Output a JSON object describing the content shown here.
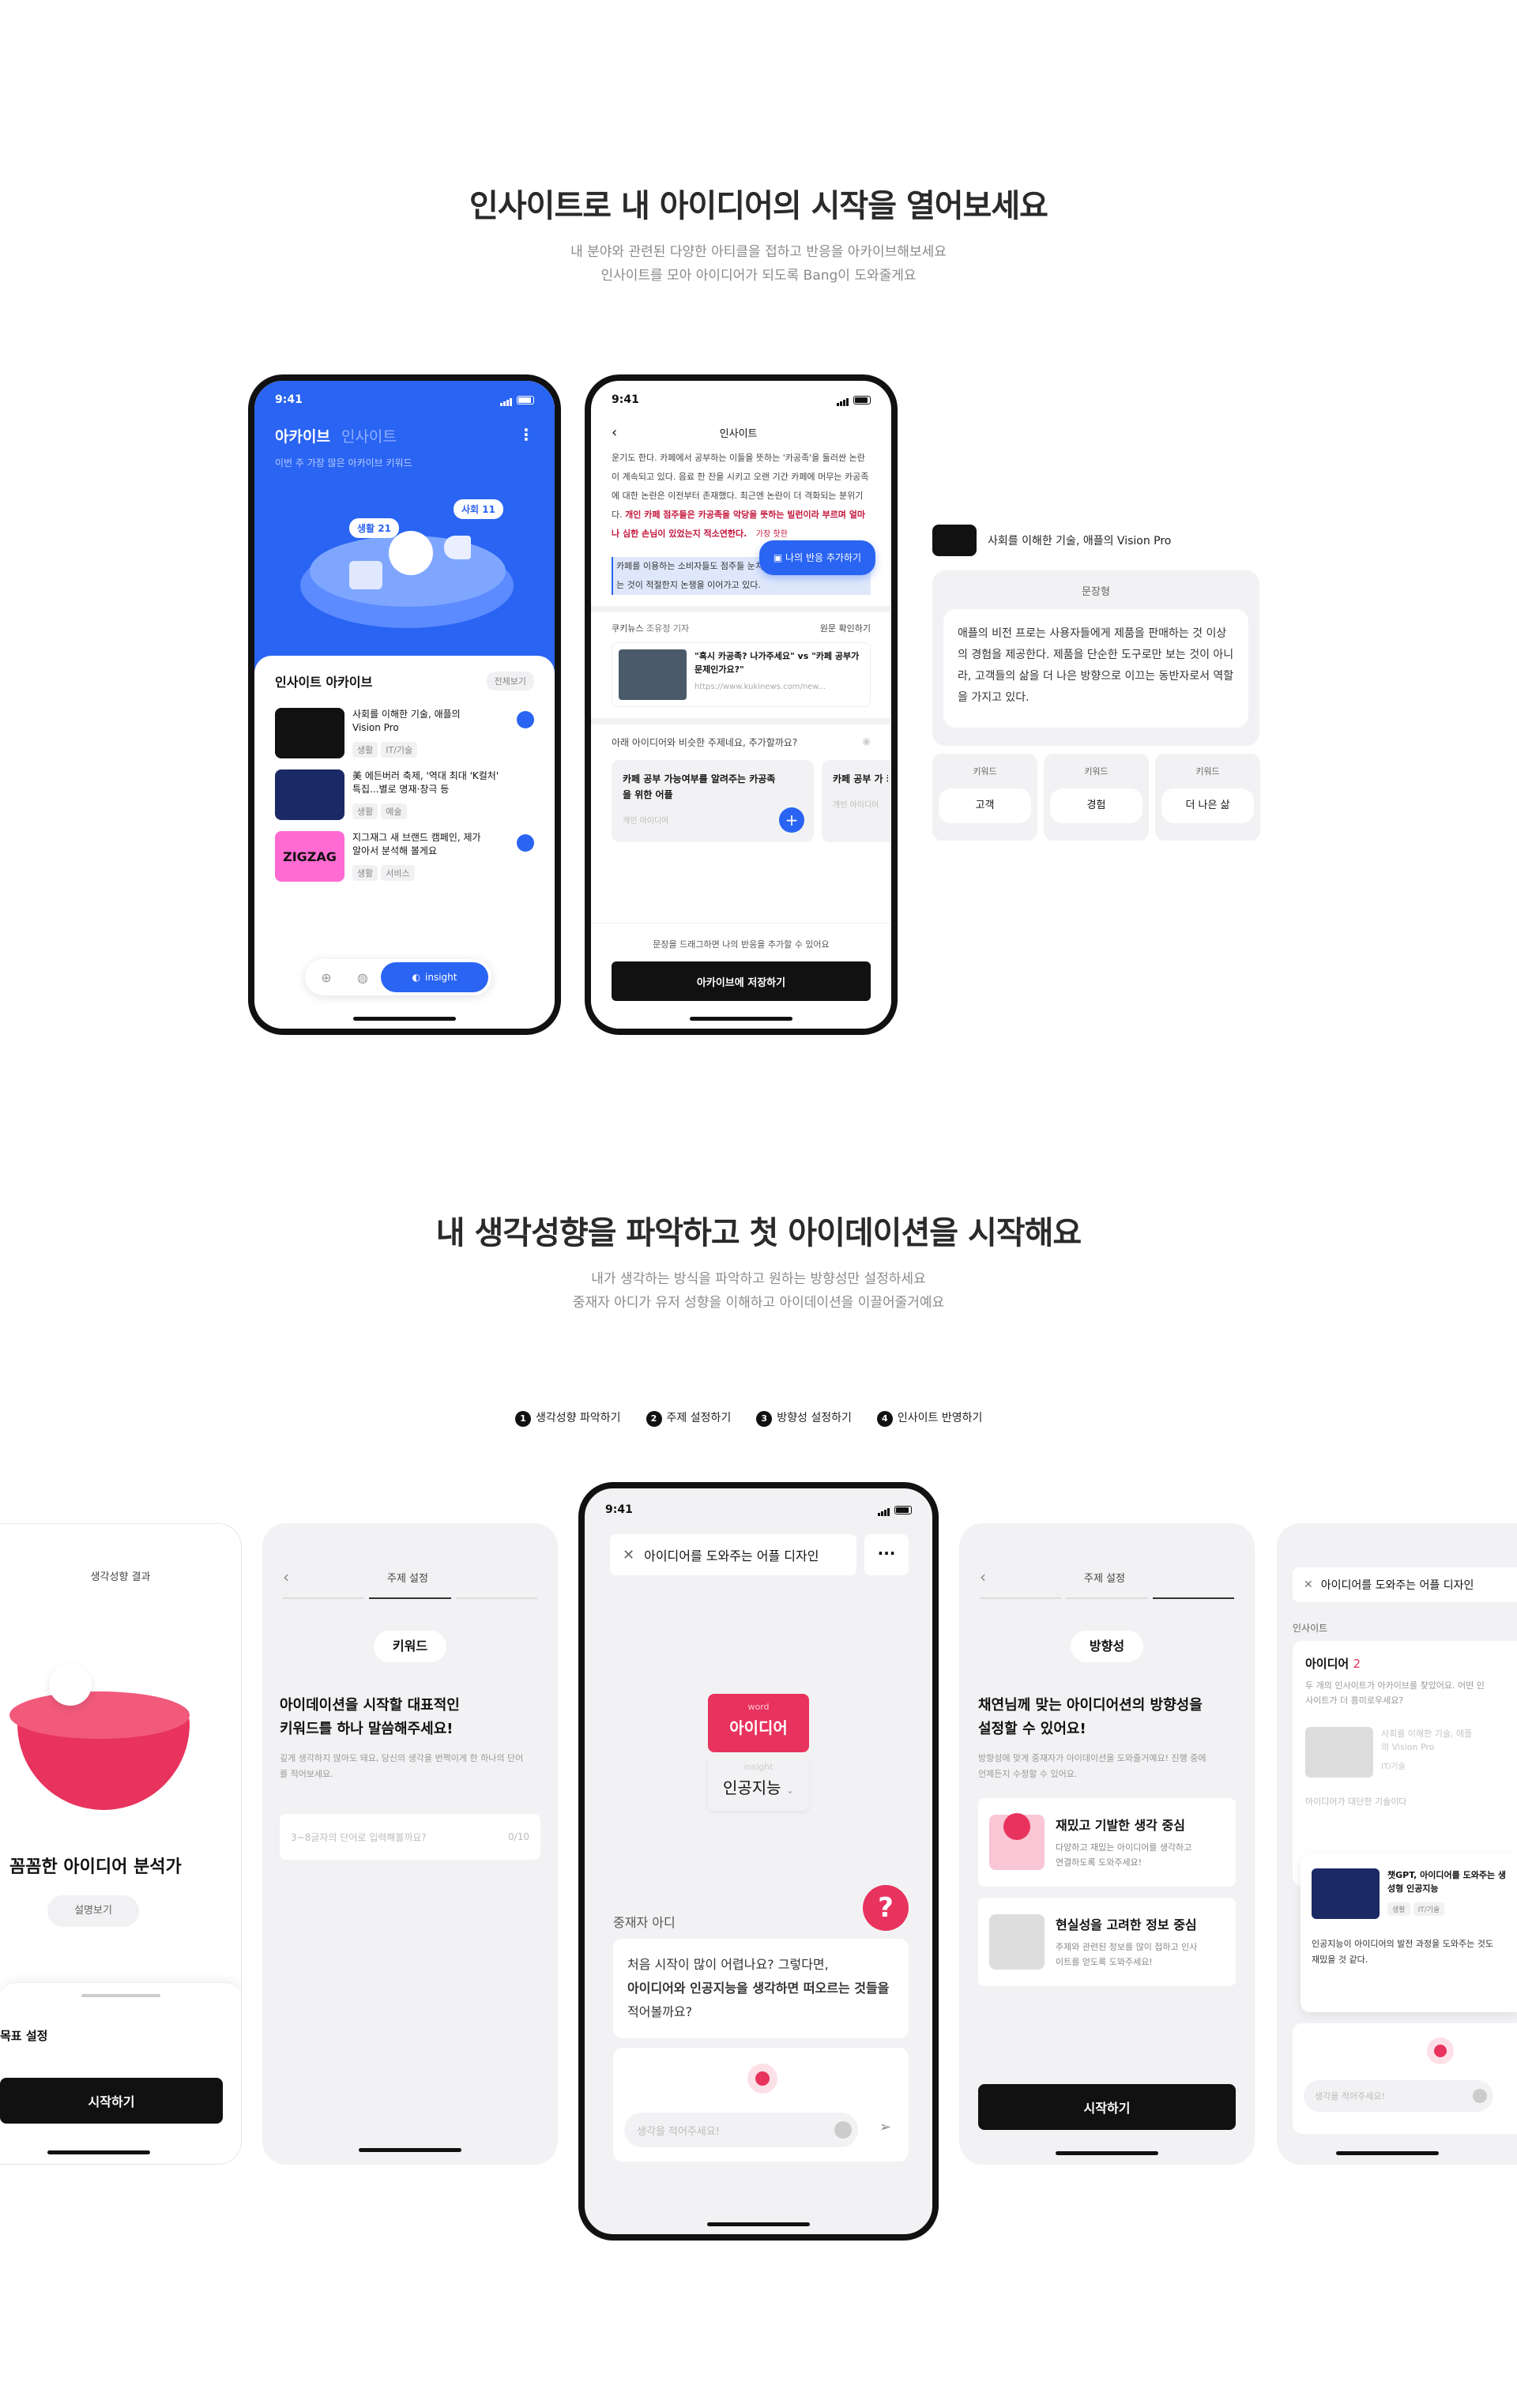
{
  "section1": {
    "title": "인사이트로 내 아이디어의 시작을 열어보세요",
    "sub1": "내 분야와 관련된 다양한 아티클을 접하고 반응을 아카이브해보세요",
    "sub2": "인사이트를 모아 아이디어가 되도록 Bang이 도와줄게요"
  },
  "phone1": {
    "time": "9:41",
    "tab_archive": "아카이브",
    "tab_insight": "인사이트",
    "hero_sub": "이번 주 가장 많은 아카이브 키워드",
    "bubble_life": "생활 21",
    "bubble_society": "사회 11",
    "list_title": "인사이트 아카이브",
    "view_all": "전체보기",
    "items": [
      {
        "title": "사회를 이해한 기술, 애플의 Vision Pro",
        "tags": [
          "생활",
          "IT/기술"
        ]
      },
      {
        "title": "美 에든버러 축제, '역대 최대 'K컬처' 특집...별로 명재·창극 등",
        "tags": [
          "생활",
          "예술"
        ]
      },
      {
        "title": "지그재그 새 브랜드 캠페인, 제가 알아서 분석해 볼게요",
        "tags": [
          "생활",
          "서비스"
        ]
      }
    ],
    "zigzag": "ZIGZAG",
    "nav_insight": "insight"
  },
  "phone2": {
    "time": "9:41",
    "title": "인사이트",
    "article": "운기도 한다. 카페에서 공부하는 이들을 뜻하는 '카공족'을 둘러싼 논란이 계속되고 있다. 음료 한 잔을 시키고 오랜 기간 카페에 머무는 카공족에 대한 논란은 이전부터 존재했다. 최근엔 논란이 더 격화되는 분위기다.",
    "highlight": "개인 카페 점주들은 카공족을 악당을 뜻하는 빌런이라 부르며 얼마나 심한 손님이 있었는지 적소연한다.",
    "most_reaction": "가장 핫한",
    "add_reaction": "나의 반응 추가하기",
    "selected": "카페를 이용하는 소비자들도 점주들 눈치를 보며 대체 얼마나 머무르는 것이 적절한지 논쟁을 이어가고 있다.",
    "source_name": "쿠키뉴스",
    "reporter": "조유정 기자",
    "view_original": "원문 확인하기",
    "news_title": "\"혹시 카공족? 나가주세요\" vs \"카페 공부가 문제인가요?\"",
    "news_url": "https://www.kukinews.com/new...",
    "similar": "아래 아이디어와 비슷한 주제네요, 추가할까요?",
    "idea1_title": "카페 공부 가능여부를 알려주는 카공족을 위한 어플",
    "idea1_tag": "개인 아이디어",
    "idea2_title": "카페 공부 가 카공족을 위",
    "idea2_tag": "개인 아이디어",
    "drag_hint": "문장을 드래그하면 나의 반응을 추가할 수 있어요",
    "save_btn": "아카이브에 저장하기"
  },
  "side_card": {
    "title": "사회를 이해한 기술, 애플의 Vision Pro",
    "summary_label": "문장형",
    "summary": "애플의 비전 프로는 사용자들에게 제품을 판매하는 것 이상의 경험을 제공한다. 제품을 단순한 도구로만 보는 것이 아니라, 고객들의 삶을 더 나은 방향으로 이끄는 동반자로서 역할을 가지고 있다.",
    "keyword_label": "키워드",
    "keywords": [
      "고객",
      "경험",
      "더 나은 삶"
    ]
  },
  "section2": {
    "title": "내 생각성향을 파악하고 첫 아이데이션을 시작해요",
    "sub1": "내가 생각하는 방식을 파악하고 원하는 방향성만 설정하세요",
    "sub2": "중재자 아디가 유저 성향을 이해하고 아이데이션을 이끌어줄거예요",
    "steps": [
      {
        "num": "1",
        "label": "생각성향 파악하기"
      },
      {
        "num": "2",
        "label": "주제 설정하기"
      },
      {
        "num": "3",
        "label": "방향성 설정하기"
      },
      {
        "num": "4",
        "label": "인사이트 반영하기"
      }
    ]
  },
  "screenA": {
    "header": "생각성향 결과",
    "result": "꼼꼼한 아이디어 분석가",
    "desc_btn": "설명보기",
    "goal": "목표 설정",
    "start": "시작하기"
  },
  "screenB": {
    "header": "주제 설정",
    "chip": "키워드",
    "q": "아이데이션을 시작할 대표적인 키워드를 하나 말씀해주세요!",
    "hint": "깊게 생각하지 않아도 돼요, 당신의 생각을 번쩍이게 한 하나의 단어를 적어보세요.",
    "placeholder": "3~8글자의 단어로 입력해볼까요?",
    "counter": "0/10"
  },
  "screenC": {
    "time": "9:41",
    "title": "아이디어를 도와주는 어플 디자인",
    "word_label": "word",
    "word_value": "아이디어",
    "insight_label": "insight",
    "insight_value": "인공지능",
    "mediator": "중재자 아디",
    "msg1": "처음 시작이 많이 어렵나요? 그렇다면,",
    "msg2": "아이디어와 인공지능을 생각하면 떠오르는 것들을",
    "msg3": "적어볼까요?",
    "input_ph": "생각을 적어주세요!"
  },
  "screenD": {
    "header": "주제 설정",
    "chip": "방향성",
    "q": "채연님께 맞는 아이디어션의 방향성을 설정할 수 있어요!",
    "hint": "방향성에 맞게 중재자가 아이데이션을 도와줄거예요! 진행 중에 언제든지 수정할 수 있어요.",
    "opt1_title": "재밌고 기발한 생각 중심",
    "opt1_desc": "다양하고 재밌는 아이디어를 생각하고 연결하도록 도와주세요!",
    "opt2_title": "현실성을 고려한 정보 중심",
    "opt2_desc": "주제와 관련된 정보를 많이 접하고 인사이트를 얻도록 도와주세요!",
    "start": "시작하기"
  },
  "screenE": {
    "title": "아이디어를 도와주는 어플 디자인",
    "tab": "인사이트",
    "idea_label": "아이디어",
    "idea_count": "2",
    "idea_desc": "두 개의 인사이트가 아카이브를 찾았어요. 어떤 인사이트가 더 흥미로우세요?",
    "ins1_title": "사회를 이해한 기술, 애플의 Vision Pro",
    "ins1_tag": "IT/기술",
    "ins1_note": "아이디어가 대단한 기술이다",
    "ins2_title": "챗GPT, 아이디어를 도와주는 생성형 인공지능",
    "ins2_tags": [
      "생활",
      "IT/기술"
    ],
    "ins2_note": "인공지능이 아이디어의 발전 과정을 도와주는 것도 재밌을 것 같다.",
    "input_ph": "생각을 적어주세요!"
  }
}
